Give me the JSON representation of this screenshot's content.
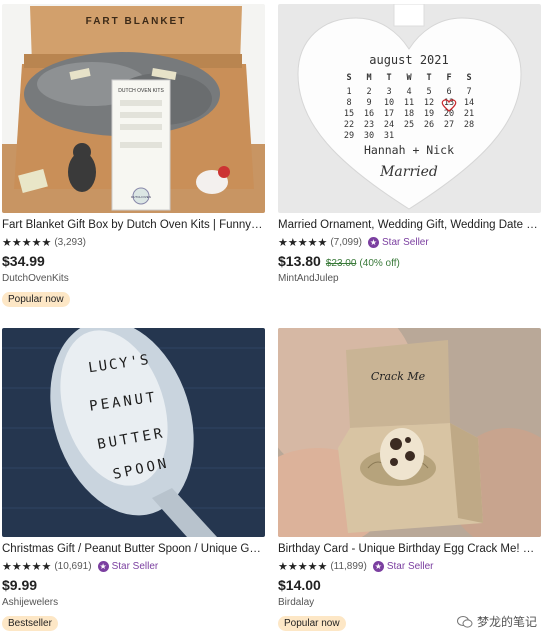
{
  "listings": [
    {
      "title": "Fart Blanket Gift Box by Dutch Oven Kits | Funny…",
      "stars": "★★★★★",
      "reviews": "(3,293)",
      "star_seller": "",
      "price": "$34.99",
      "original_price": "",
      "discount": "",
      "shop": "DutchOvenKits",
      "badge": "Popular now",
      "image": {
        "box_label": "FART BLANKET",
        "card_title": "DUTCH OVEN KITS",
        "card_seal": "DUTCH OVEN"
      }
    },
    {
      "title": "Married Ornament, Wedding Gift, Wedding Date O…",
      "stars": "★★★★★",
      "reviews": "(7,099)",
      "star_seller": "Star Seller",
      "price": "$13.80",
      "original_price": "$23.00",
      "discount": "(40% off)",
      "shop": "MintAndJulep",
      "badge": "",
      "image": {
        "month": "august 2021",
        "weekdays": [
          "S",
          "M",
          "T",
          "W",
          "T",
          "F",
          "S"
        ],
        "weeks": [
          [
            "1",
            "2",
            "3",
            "4",
            "5",
            "6",
            "7"
          ],
          [
            "8",
            "9",
            "10",
            "11",
            "12",
            "13",
            "14"
          ],
          [
            "15",
            "16",
            "17",
            "18",
            "19",
            "20",
            "21"
          ],
          [
            "22",
            "23",
            "24",
            "25",
            "26",
            "27",
            "28"
          ],
          [
            "29",
            "30",
            "31",
            "",
            "",
            "",
            ""
          ]
        ],
        "names": "Hannah + Nick",
        "script": "Married"
      }
    },
    {
      "title": "Christmas Gift / Peanut Butter Spoon / Unique G…",
      "stars": "★★★★★",
      "reviews": "(10,691)",
      "star_seller": "Star Seller",
      "price": "$9.99",
      "original_price": "",
      "discount": "",
      "shop": "Ashijewelers",
      "badge": "Bestseller",
      "image": {
        "lines": [
          "LUCY'S",
          "PEANUT",
          "BUTTER",
          "SPOON"
        ]
      }
    },
    {
      "title": "Birthday Card - Unique Birthday Egg Crack Me! B…",
      "stars": "★★★★★",
      "reviews": "(11,899)",
      "star_seller": "Star Seller",
      "price": "$14.00",
      "original_price": "",
      "discount": "",
      "shop": "Birdalay",
      "badge": "Popular now",
      "image": {
        "box_text": "Crack Me"
      }
    }
  ],
  "watermark": {
    "text": "梦龙的笔记"
  },
  "colors": {
    "star_seller": "#7b3fa0",
    "badge_bg": "#fde7c6",
    "discount": "#3a7a3a"
  }
}
